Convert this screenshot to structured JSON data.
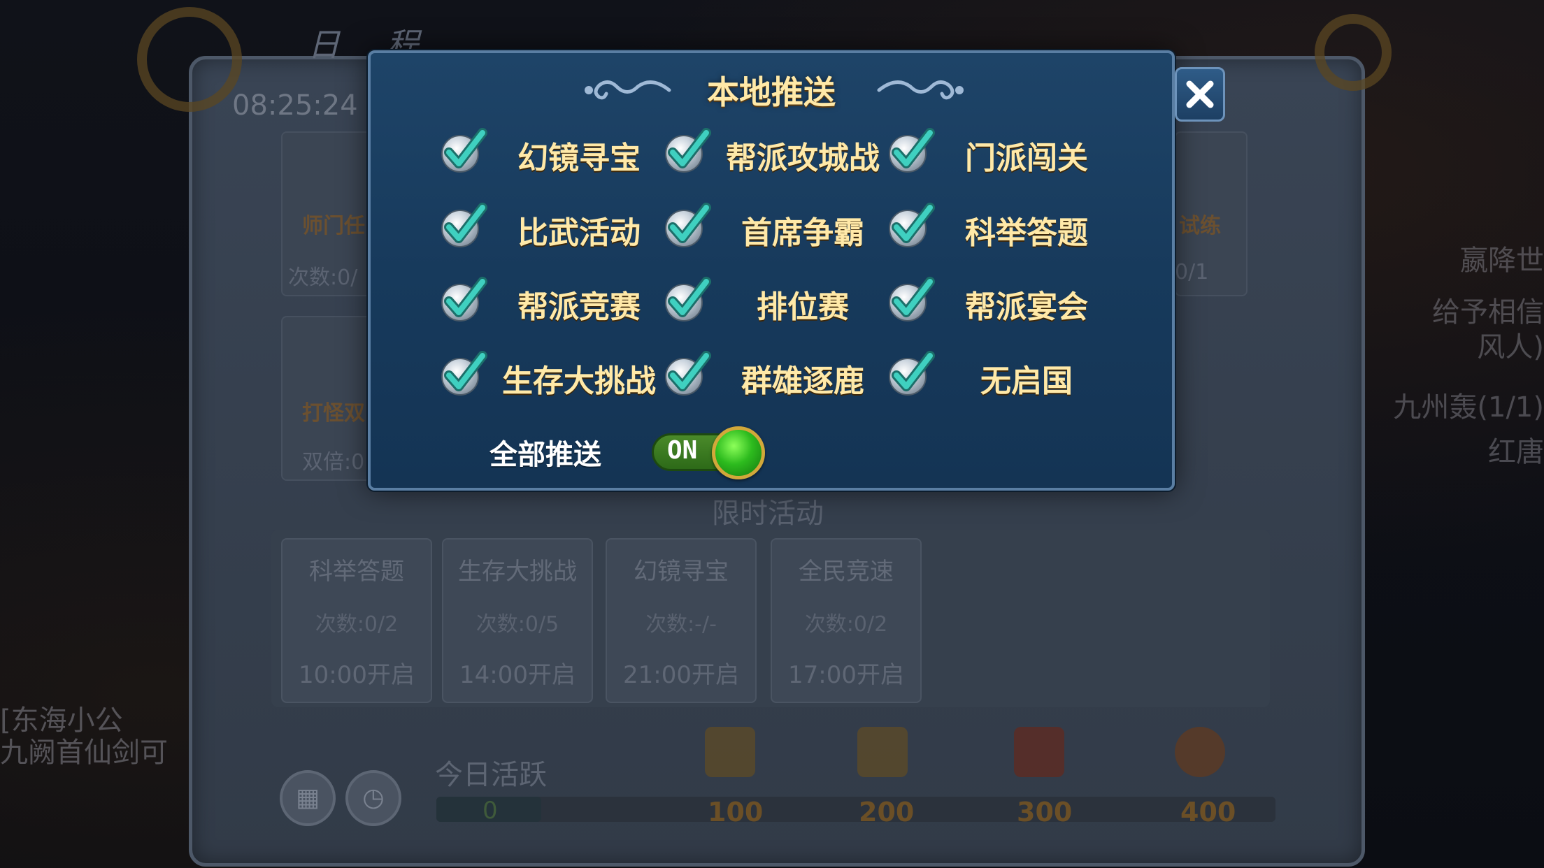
{
  "background": {
    "panel_title": "日 程",
    "time": "08:25:24",
    "left_side_texts": [
      "[东海小公",
      "九阙首仙剑可"
    ],
    "right_side_texts": [
      "嬴降世",
      "给予相信",
      "风人)",
      "九州轰(1/1)",
      "红唐"
    ],
    "top_cards": [
      {
        "name": "师门任",
        "count": "次数:0/"
      },
      {
        "name": "试练",
        "count": "0/1"
      }
    ],
    "second_row_card": {
      "name": "打怪双",
      "count": "双倍:0"
    },
    "limited_title": "限时活动",
    "limited_activities": [
      {
        "name": "科举答题",
        "count": "次数:0/2",
        "time": "10:00开启"
      },
      {
        "name": "生存大挑战",
        "count": "次数:0/5",
        "time": "14:00开启"
      },
      {
        "name": "幻镜寻宝",
        "count": "次数:-/-",
        "time": "21:00开启"
      },
      {
        "name": "全民竞速",
        "count": "次数:0/2",
        "time": "17:00开启"
      }
    ],
    "active_label": "今日活跃",
    "active_value": "0",
    "active_progress": 0,
    "milestones": [
      "100",
      "200",
      "300",
      "400"
    ],
    "buttons": {
      "calendar_icon": "calendar-icon",
      "clock_icon": "alarm-clock-icon"
    }
  },
  "dialog": {
    "title": "本地推送",
    "close_icon": "close-icon",
    "items": [
      {
        "label": "幻镜寻宝",
        "checked": true
      },
      {
        "label": "帮派攻城战",
        "checked": true
      },
      {
        "label": "门派闯关",
        "checked": true
      },
      {
        "label": "比武活动",
        "checked": true
      },
      {
        "label": "首席争霸",
        "checked": true
      },
      {
        "label": "科举答题",
        "checked": true
      },
      {
        "label": "帮派竞赛",
        "checked": true
      },
      {
        "label": "排位赛",
        "checked": true
      },
      {
        "label": "帮派宴会",
        "checked": true
      },
      {
        "label": "生存大挑战",
        "checked": true
      },
      {
        "label": "群雄逐鹿",
        "checked": true
      },
      {
        "label": "无启国",
        "checked": true
      }
    ],
    "all_push_label": "全部推送",
    "toggle_state": "ON"
  },
  "colors": {
    "dialog_bg": "#1a3d60",
    "title_gold": "#ffe9a8",
    "check_teal": "#3fd0c0",
    "toggle_green": "#2dbb1e"
  }
}
